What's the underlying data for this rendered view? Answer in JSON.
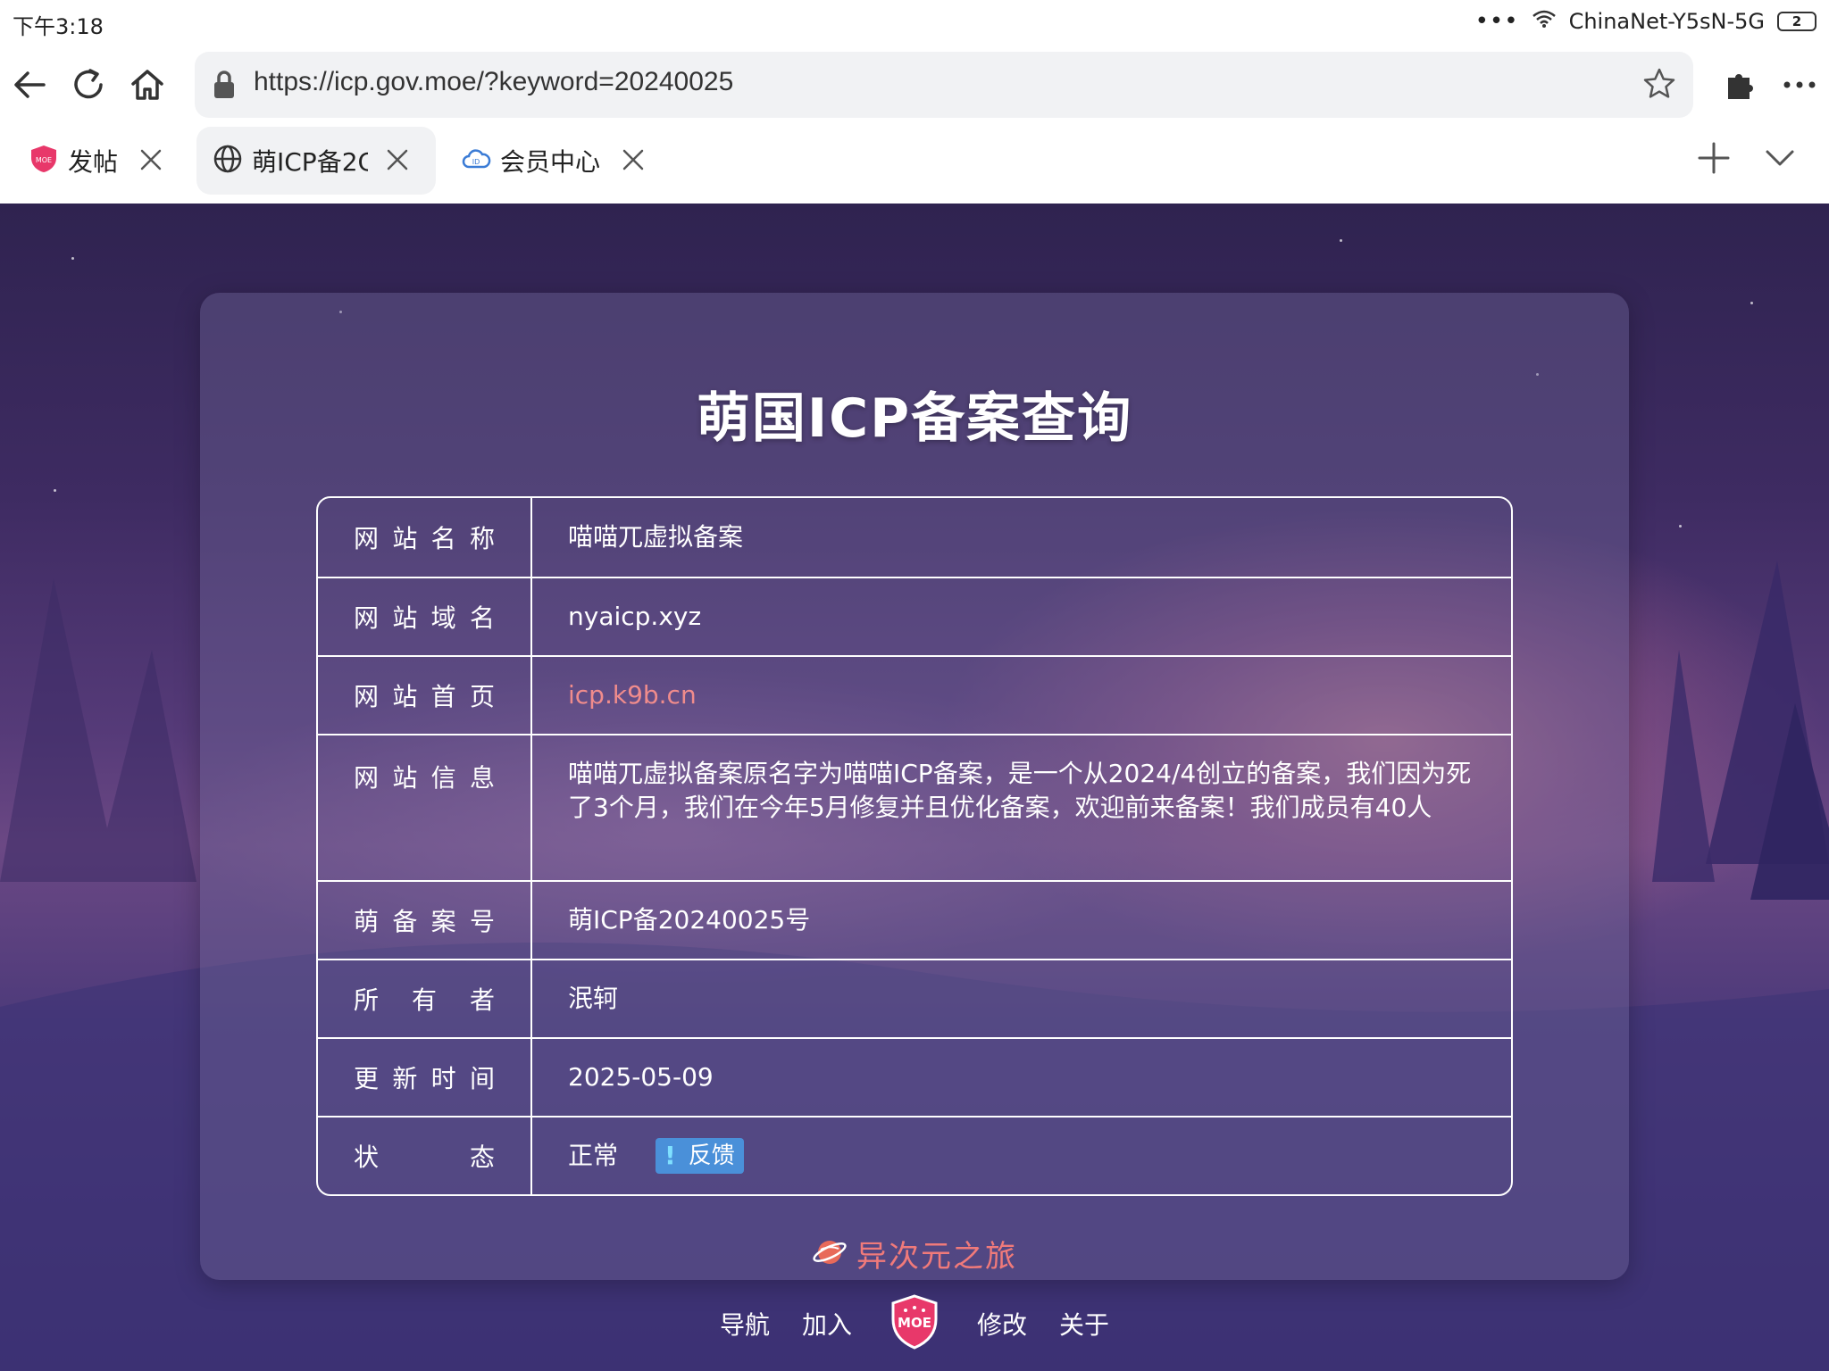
{
  "status_bar": {
    "time": "下午3:18",
    "dots": "•••",
    "network": "ChinaNet-Y5sN-5G",
    "battery": "2"
  },
  "toolbar": {
    "url": "https://icp.gov.moe/?keyword=20240025",
    "icons": [
      "back-arrow-icon",
      "reload-icon",
      "home-icon",
      "lock-icon",
      "star-icon",
      "extension-icon",
      "more-icon"
    ]
  },
  "tabs": [
    {
      "label": "发帖",
      "icon": "moe-shield-icon",
      "active": false
    },
    {
      "label": "萌ICP备2C",
      "icon": "globe-icon",
      "active": true
    },
    {
      "label": "会员中心",
      "icon": "cloud-icon",
      "active": false
    }
  ],
  "page": {
    "title": "萌国ICP备案查询",
    "rows": [
      {
        "label": [
          "网",
          "站",
          "名",
          "称"
        ],
        "value": "喵喵兀虚拟备案"
      },
      {
        "label": [
          "网",
          "站",
          "域",
          "名"
        ],
        "value": "nyaicp.xyz"
      },
      {
        "label": [
          "网",
          "站",
          "首",
          "页"
        ],
        "value": "icp.k9b.cn"
      },
      {
        "label": [
          "网",
          "站",
          "信",
          "息"
        ],
        "value": "喵喵兀虚拟备案原名字为喵喵ICP备案，是一个从2024/4创立的备案，我们因为死了3个月，我们在今年5月修复并且优化备案，欢迎前来备案！我们成员有40人"
      },
      {
        "label": [
          "萌",
          "备",
          "案",
          "号"
        ],
        "value": "萌ICP备20240025号"
      },
      {
        "label": [
          "所",
          "有",
          "者"
        ],
        "value": "泯轲"
      },
      {
        "label": [
          "更",
          "新",
          "时",
          "间"
        ],
        "value": "2025-05-09"
      },
      {
        "label": [
          "状",
          "态"
        ],
        "value": "正常"
      }
    ],
    "feedback_label": "反馈",
    "feedback_mark": "!",
    "brand": "异次元之旅",
    "nav": [
      "导航",
      "加入",
      "修改",
      "关于"
    ],
    "logo_text": "MOE"
  },
  "colors": {
    "link": "#f08c8c",
    "feedback_bg": "#4a90d9",
    "brand": "#f07a7a",
    "logo": "#e8386a"
  }
}
